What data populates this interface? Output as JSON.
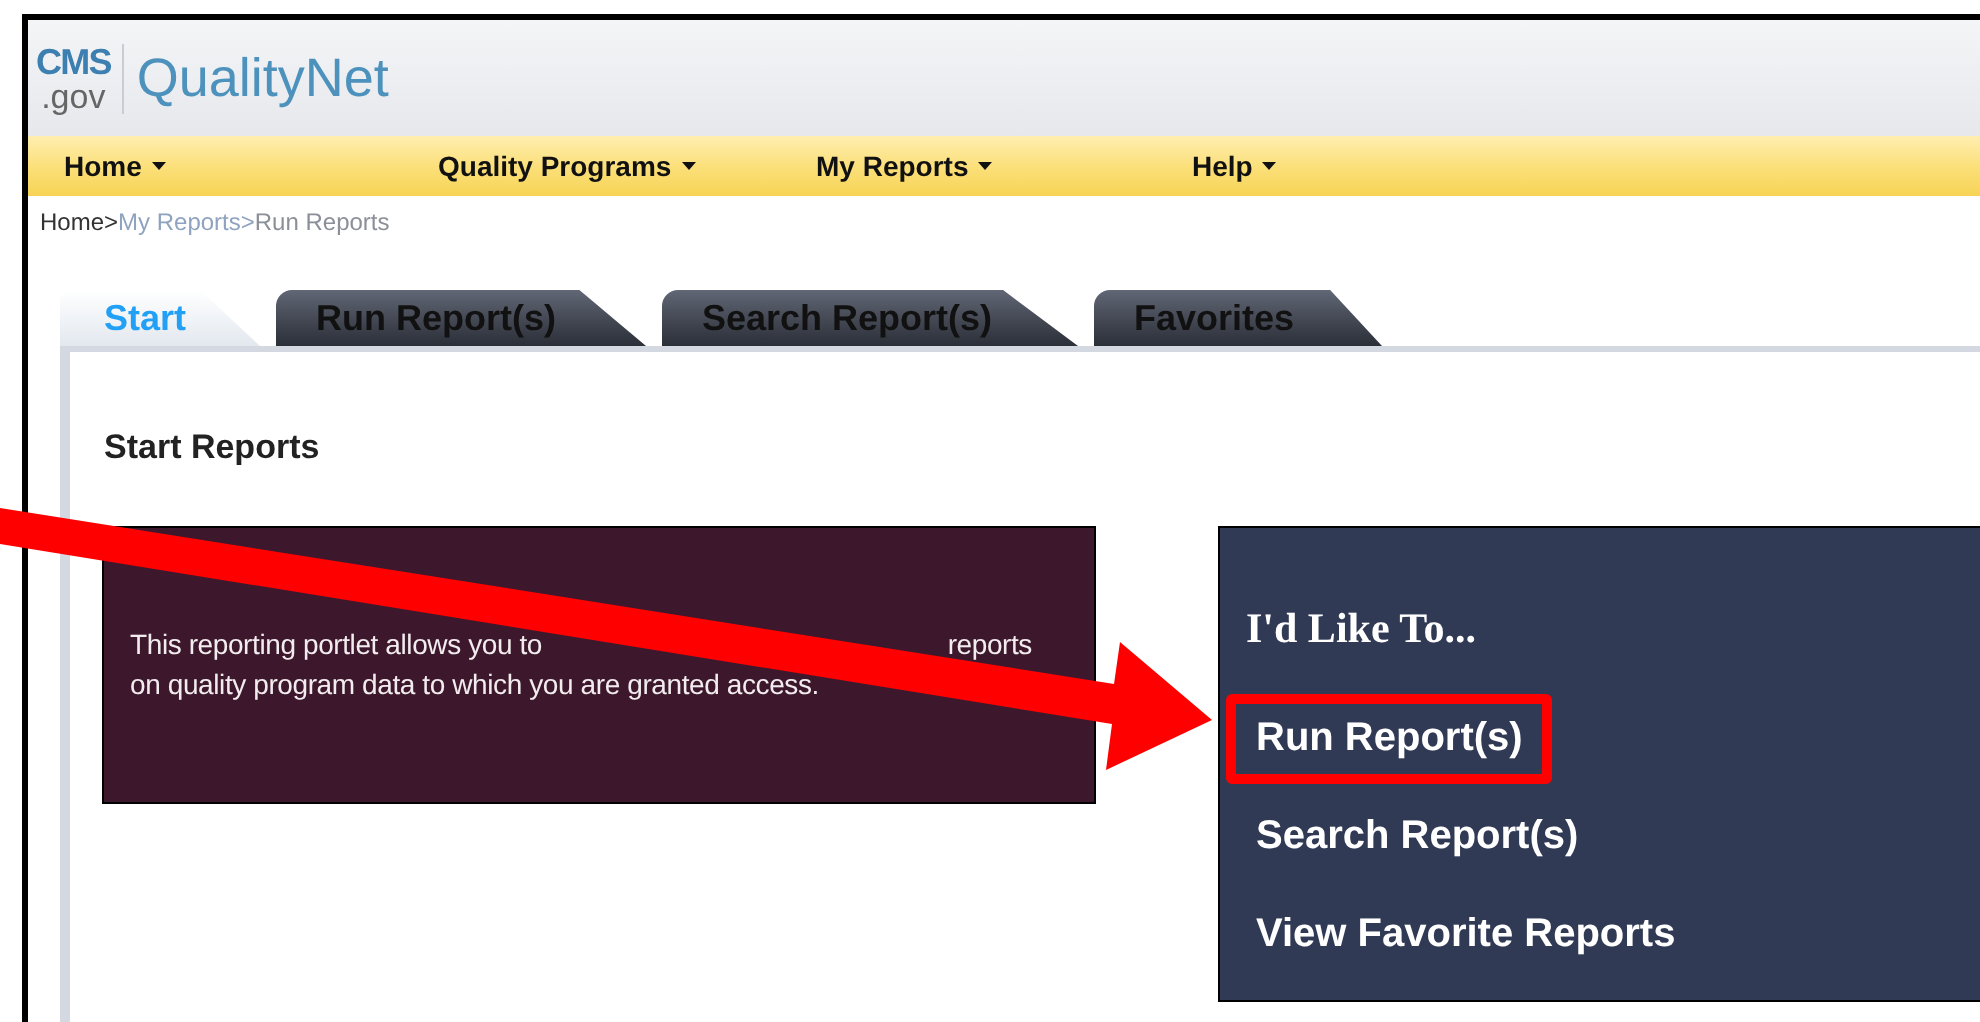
{
  "header": {
    "logo_top": "CMS",
    "logo_bottom": ".gov",
    "site_name": "QualityNet"
  },
  "nav": [
    {
      "label": "Home"
    },
    {
      "label": "Quality Programs"
    },
    {
      "label": "My Reports"
    },
    {
      "label": "Help"
    }
  ],
  "breadcrumb": [
    {
      "label": "Home>",
      "color": "#333333"
    },
    {
      "label": "My Reports>",
      "color": "#8fa3c0"
    },
    {
      "label": "Run Reports",
      "color": "#8a8f98"
    }
  ],
  "tabs": [
    {
      "label": "Start",
      "selected": true
    },
    {
      "label": "Run Report(s)",
      "selected": false
    },
    {
      "label": "Search Report(s)",
      "selected": false
    },
    {
      "label": "Favorites",
      "selected": false
    }
  ],
  "section_title": "Start Reports",
  "description": {
    "line_1_start": "This reporting portlet allows you to",
    "line_1_end": "reports",
    "line_2": "on quality program data to which you are granted access."
  },
  "actions": {
    "heading": "I'd Like To...",
    "links": [
      {
        "label": "Run Report(s)",
        "highlighted": true
      },
      {
        "label": "Search Report(s)",
        "highlighted": false
      },
      {
        "label": "View Favorite Reports",
        "highlighted": false
      }
    ]
  }
}
